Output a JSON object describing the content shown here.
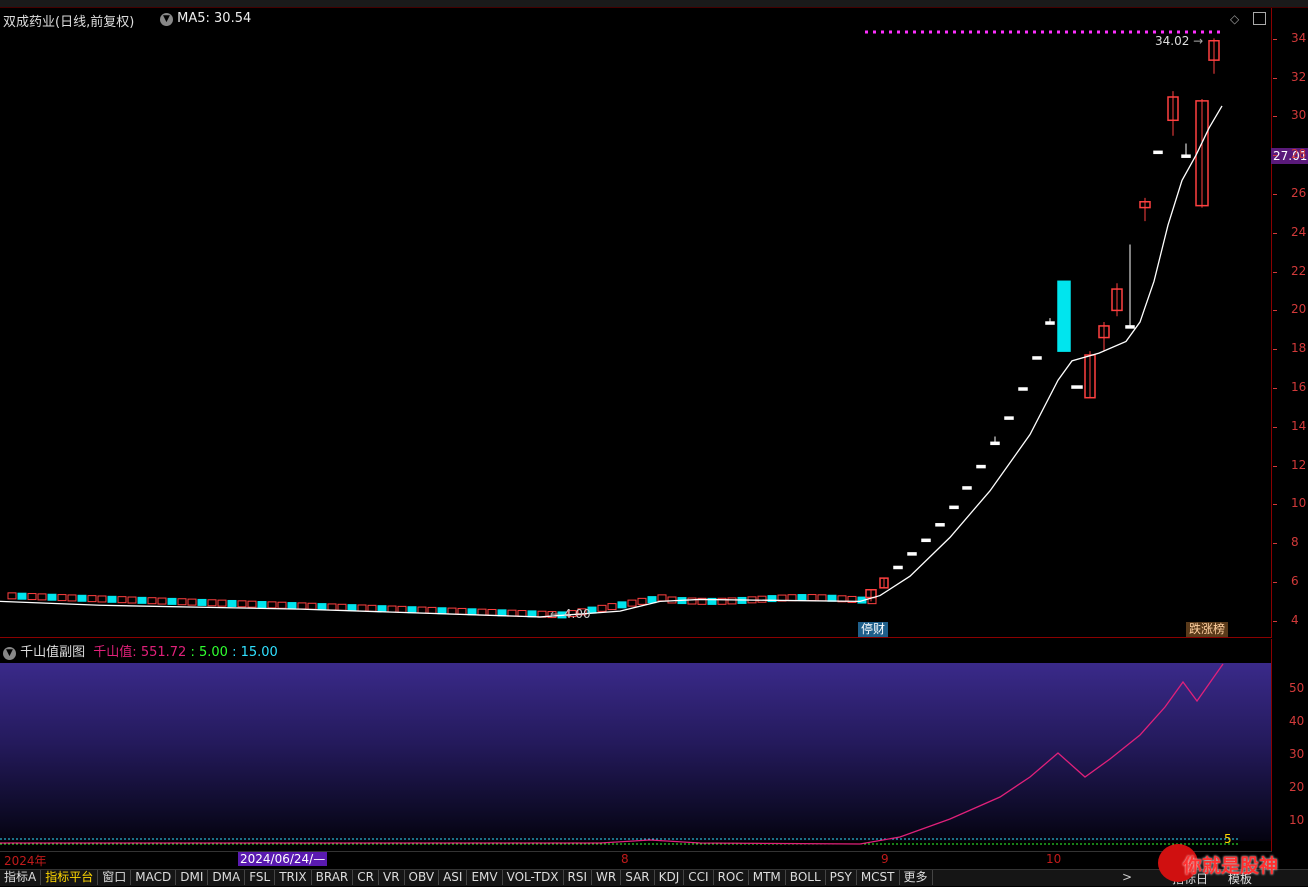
{
  "header": {
    "stock_title": "双成药业(日线,前复权)",
    "ma_label": "MA5: 30.54"
  },
  "price_axis": {
    "ticks": [
      "34",
      "32",
      "30",
      "28",
      "26",
      "24",
      "22",
      "20",
      "18",
      "16",
      "14",
      "12",
      "10",
      "8",
      "6",
      "4"
    ],
    "current_price": "27.01"
  },
  "annotations": {
    "high_label": "34.02",
    "low_label": "4.00",
    "event_badge_1": "停财",
    "event_badge_2": "跌涨榜"
  },
  "sub_indicator": {
    "title": "千山值副图",
    "line_name": "千山值:",
    "value_main": "551.72",
    "value_2": ": 5.00",
    "value_3": ": 15.00",
    "axis_ticks": [
      "50",
      "40",
      "30",
      "20",
      "10"
    ],
    "level_marker": "5"
  },
  "dates": {
    "year": "2024年",
    "cursor_date": "2024/06/24/—",
    "month_8": "8",
    "month_9": "9",
    "month_10": "10"
  },
  "tabs": [
    "指标A",
    "指标平台",
    "窗口",
    "MACD",
    "DMI",
    "DMA",
    "FSL",
    "TRIX",
    "BRAR",
    "CR",
    "VR",
    "OBV",
    "ASI",
    "EMV",
    "VOL-TDX",
    "RSI",
    "WR",
    "SAR",
    "KDJ",
    "CCI",
    "ROC",
    "MTM",
    "BOLL",
    "PSY",
    "MCST",
    "更多"
  ],
  "right_tabs": {
    "indicator_day": "指标日",
    "template": "模板"
  },
  "watermark": "你就是股神",
  "colors": {
    "up": "#ff4040",
    "down": "#00e5ee",
    "ma_line": "#ffffff",
    "indicator_line": "#e0207a",
    "accent_axis": "#d23a3a"
  },
  "chart_data": {
    "type": "candlestick",
    "title": "双成药业(日线,前复权)",
    "ylim": [
      3,
      35
    ],
    "ma5_last": 30.54,
    "high": 34.02,
    "low": 4.0,
    "last": 27.01,
    "candles_recent": [
      {
        "o": 5.2,
        "h": 5.6,
        "l": 5.0,
        "c": 5.6
      },
      {
        "o": 5.7,
        "h": 6.2,
        "l": 5.7,
        "c": 6.2
      },
      {
        "o": 6.8,
        "h": 6.8,
        "l": 6.8,
        "c": 6.8
      },
      {
        "o": 7.5,
        "h": 7.5,
        "l": 7.5,
        "c": 7.5
      },
      {
        "o": 8.2,
        "h": 8.2,
        "l": 8.2,
        "c": 8.2
      },
      {
        "o": 9.0,
        "h": 9.0,
        "l": 9.0,
        "c": 9.0
      },
      {
        "o": 9.9,
        "h": 9.9,
        "l": 9.9,
        "c": 9.9
      },
      {
        "o": 10.9,
        "h": 10.9,
        "l": 10.9,
        "c": 10.9
      },
      {
        "o": 12.0,
        "h": 12.0,
        "l": 12.0,
        "c": 12.0
      },
      {
        "o": 13.2,
        "h": 13.5,
        "l": 13.2,
        "c": 13.2
      },
      {
        "o": 14.5,
        "h": 14.5,
        "l": 14.5,
        "c": 14.5
      },
      {
        "o": 16.0,
        "h": 16.0,
        "l": 16.0,
        "c": 16.0
      },
      {
        "o": 17.6,
        "h": 17.6,
        "l": 17.6,
        "c": 17.6
      },
      {
        "o": 19.4,
        "h": 19.6,
        "l": 19.4,
        "c": 19.4
      },
      {
        "o": 21.5,
        "h": 21.5,
        "l": 17.9,
        "c": 17.9
      },
      {
        "o": 16.1,
        "h": 16.1,
        "l": 16.1,
        "c": 16.1
      },
      {
        "o": 15.5,
        "h": 17.9,
        "l": 15.5,
        "c": 17.7
      },
      {
        "o": 18.6,
        "h": 19.4,
        "l": 17.9,
        "c": 19.2
      },
      {
        "o": 20.0,
        "h": 21.4,
        "l": 19.7,
        "c": 21.1
      },
      {
        "o": 19.2,
        "h": 23.4,
        "l": 19.2,
        "c": 19.2
      },
      {
        "o": 25.3,
        "h": 25.8,
        "l": 24.6,
        "c": 25.6
      },
      {
        "o": 28.2,
        "h": 28.2,
        "l": 28.2,
        "c": 28.2
      },
      {
        "o": 29.8,
        "h": 31.3,
        "l": 29.0,
        "c": 31.0
      },
      {
        "o": 28.0,
        "h": 28.6,
        "l": 28.0,
        "c": 28.0
      },
      {
        "o": 25.4,
        "h": 30.9,
        "l": 25.3,
        "c": 30.8
      },
      {
        "o": 32.9,
        "h": 34.02,
        "l": 32.2,
        "c": 33.9
      }
    ]
  }
}
